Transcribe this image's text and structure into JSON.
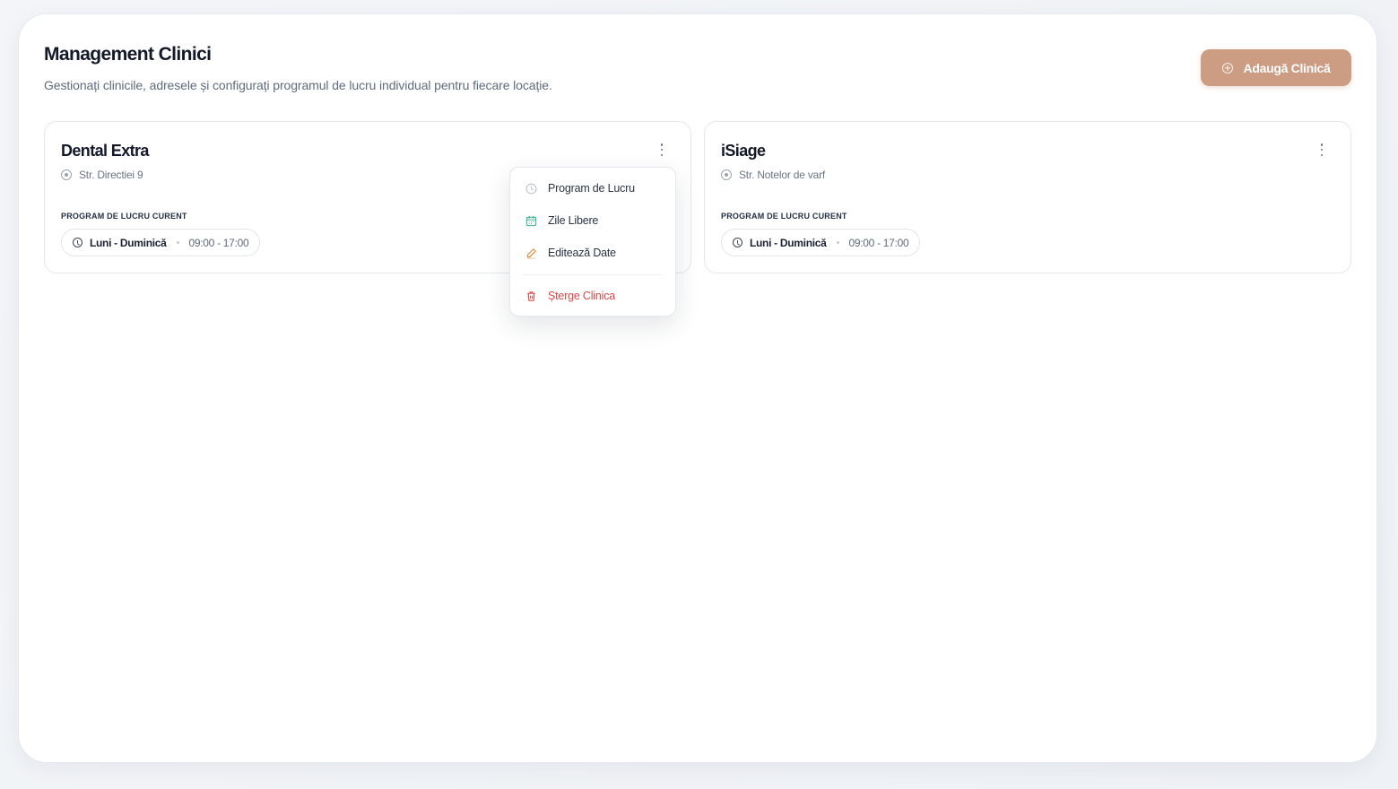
{
  "header": {
    "title": "Management Clinici",
    "subtitle": "Gestionați clinicile, adresele și configurați programul de lucru individual pentru fiecare locație.",
    "add_button_label": "Adaugă Clinică",
    "add_icon": "plus-circle-icon"
  },
  "clinics": [
    {
      "name": "Dental Extra",
      "address": "Str. Directiei 9",
      "schedule_label": "PROGRAM DE LUCRU CURENT",
      "schedule_days": "Luni - Duminică",
      "schedule_hours": "09:00 - 17:00"
    },
    {
      "name": "iSiage",
      "address": "Str. Notelor de varf",
      "schedule_label": "PROGRAM DE LUCRU CURENT",
      "schedule_days": "Luni - Duminică",
      "schedule_hours": "09:00 - 17:00"
    }
  ],
  "dropdown": {
    "items": [
      {
        "label": "Program de Lucru",
        "icon": "clock-icon"
      },
      {
        "label": "Zile Libere",
        "icon": "calendar-icon"
      },
      {
        "label": "Editează Date",
        "icon": "pencil-icon"
      },
      {
        "label": "Șterge Clinica",
        "icon": "trash-icon"
      }
    ]
  },
  "colors": {
    "accent": "#cc9d83",
    "danger": "#dc4848",
    "calendar": "#3bb38a",
    "edit": "#e08a3c"
  }
}
